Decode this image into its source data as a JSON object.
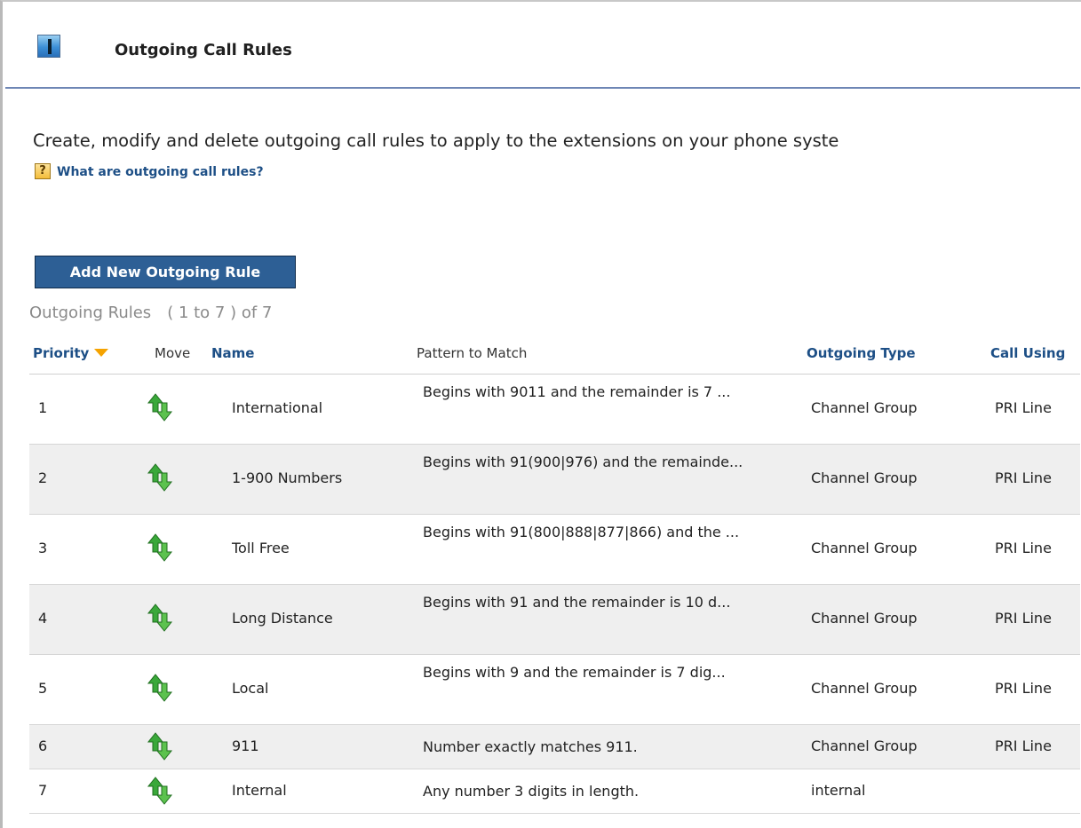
{
  "header": {
    "title": "Outgoing Call Rules"
  },
  "intro": {
    "description": "Create, modify and delete outgoing call rules to apply to the extensions on your phone syste",
    "help_icon_glyph": "?",
    "help_link": "What are outgoing call rules?"
  },
  "toolbar": {
    "add_button_label": "Add New Outgoing Rule"
  },
  "summary": {
    "label": "Outgoing Rules",
    "range": "( 1 to 7 ) of 7"
  },
  "table": {
    "columns": {
      "priority": "Priority",
      "move": "Move",
      "name": "Name",
      "pattern": "Pattern to Match",
      "outgoing_type": "Outgoing Type",
      "call_using": "Call Using"
    },
    "rows": [
      {
        "priority": "1",
        "name": "International",
        "pattern": "Begins with 9011 and the remainder is 7 ...",
        "type": "Channel Group",
        "call_using": "PRI Line"
      },
      {
        "priority": "2",
        "name": "1-900 Numbers",
        "pattern": "Begins with 91(900|976) and the remainde...",
        "type": "Channel Group",
        "call_using": "PRI Line"
      },
      {
        "priority": "3",
        "name": "Toll Free",
        "pattern": "Begins with 91(800|888|877|866) and the ...",
        "type": "Channel Group",
        "call_using": "PRI Line"
      },
      {
        "priority": "4",
        "name": "Long Distance",
        "pattern": "Begins with 91 and the remainder is 10 d...",
        "type": "Channel Group",
        "call_using": "PRI Line"
      },
      {
        "priority": "5",
        "name": "Local",
        "pattern": "Begins with 9 and the remainder is 7 dig...",
        "type": "Channel Group",
        "call_using": "PRI Line"
      },
      {
        "priority": "6",
        "name": "911",
        "pattern": "Number exactly matches 911.",
        "type": "Channel Group",
        "call_using": "PRI Line"
      },
      {
        "priority": "7",
        "name": "Internal",
        "pattern": "Any number 3 digits in length.",
        "type": "internal",
        "call_using": ""
      }
    ]
  },
  "colors": {
    "link": "#1d4f86",
    "button_bg": "#2d5f95",
    "header_rule": "#6e86b5",
    "move_icon": "#2fa02f",
    "sort_arrow": "#f5a300"
  },
  "icons": {
    "header": "info-icon",
    "help": "help-icon",
    "sort": "sort-desc-icon",
    "move": "move-up-down-icon"
  }
}
